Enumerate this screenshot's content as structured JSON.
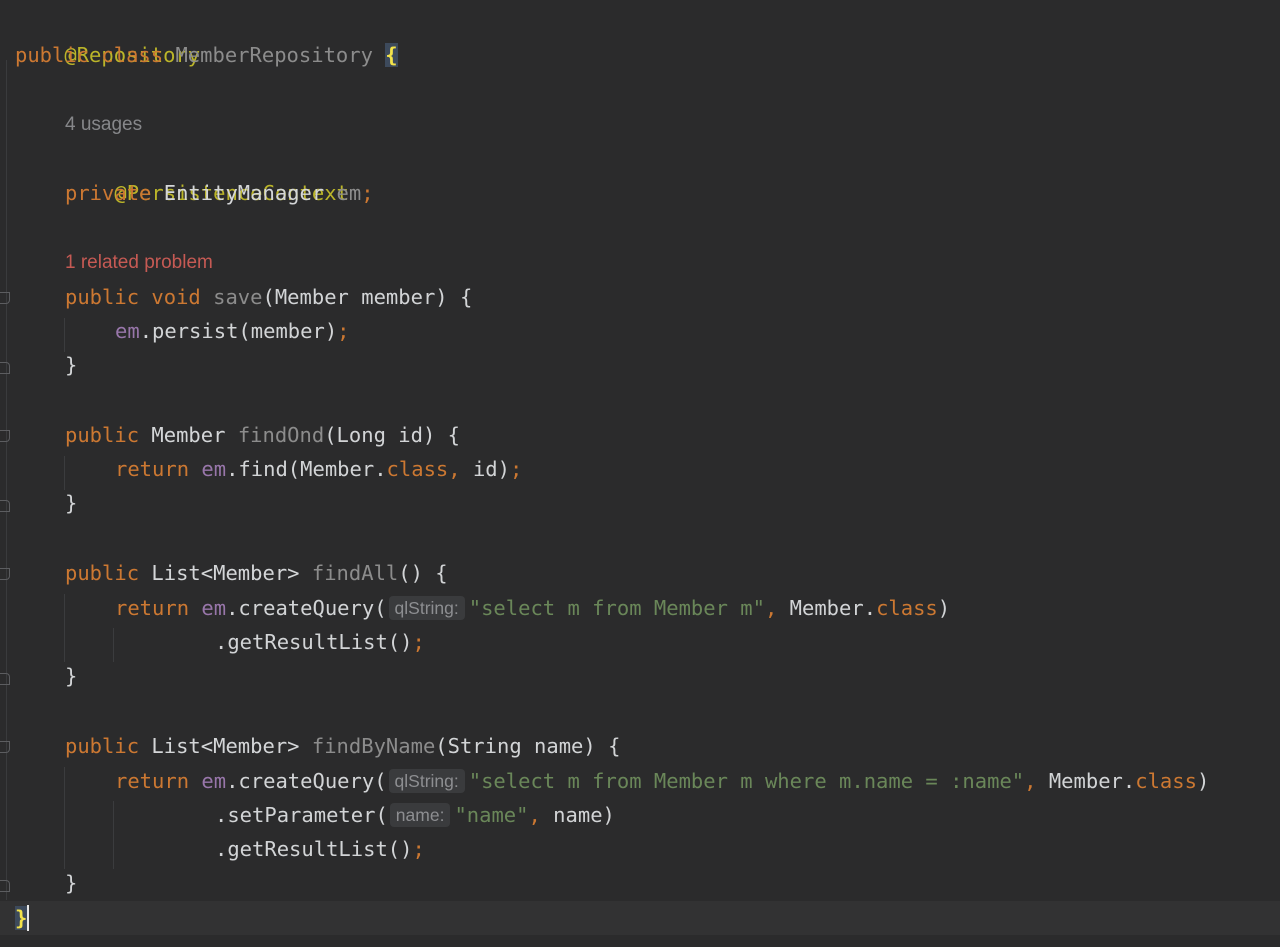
{
  "code": {
    "l1_annotation": "@Repository",
    "l2_public": "public",
    "l2_class": "class",
    "l2_classname": "MemberRepository",
    "l2_brace": "{",
    "l3_usages": "4 usages",
    "l4_annotation": "@PersistenceContext",
    "l5_private": "private",
    "l5_type": "EntityManager",
    "l5_field": "em",
    "semicolon": ";",
    "l6_problem": "1 related problem",
    "public": "public",
    "void": "void",
    "save_name": "save",
    "save_params": "(Member member) {",
    "em": "em",
    "persist_call": ".persist(member)",
    "close_brace": "}",
    "member_type": "Member",
    "findOnd_name": "findOnd",
    "findOnd_params": "(Long id) {",
    "return": "return",
    "find_call": ".find(Member.",
    "class_kw": "class",
    "comma": ",",
    "id_close": " id)",
    "list_type": "List<Member>",
    "findAll_name": "findAll",
    "findAll_params": "() {",
    "createQuery": ".createQuery(",
    "qlstring_hint": "qlString:",
    "query1": "\"select m from Member m\"",
    "member_dot": " Member.",
    "paren_close": ")",
    "getResultList": ".getResultList()",
    "findByName_name": "findByName",
    "findByName_params": "(String name) {",
    "query2": "\"select m from Member m where m.name = :name\"",
    "setParameter": ".setParameter(",
    "name_hint": "name:",
    "name_str": "\"name\"",
    "name_close": " name)",
    "final_brace": "}"
  },
  "colors": {
    "background": "#2b2b2c",
    "annotation": "#bbb529",
    "keyword": "#cc7832",
    "string": "#6a8759",
    "field": "#9876aa",
    "problem": "#c65a54"
  }
}
